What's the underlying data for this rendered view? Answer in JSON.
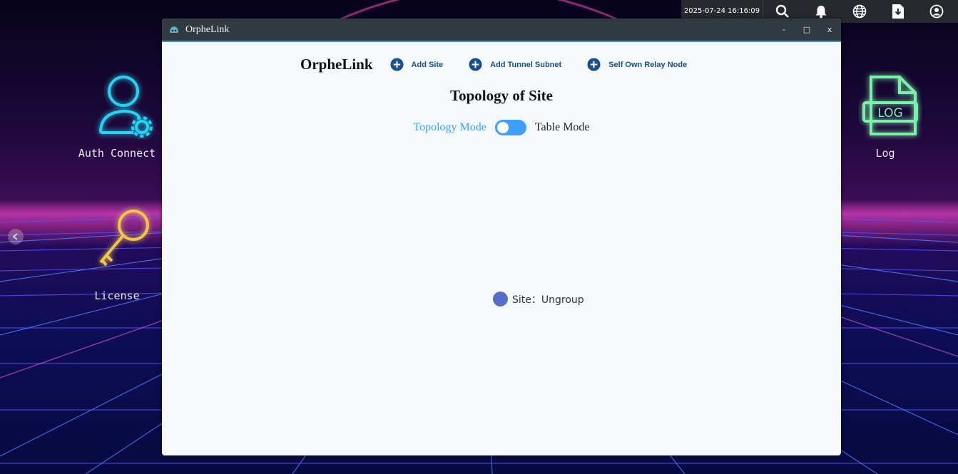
{
  "status_bar": {
    "datetime": "2025-07-24 16:16:09",
    "icons": [
      "search-icon",
      "bell-icon",
      "globe-icon",
      "download-icon",
      "user-circle-icon"
    ]
  },
  "desktop": {
    "items": [
      {
        "label": "Auth Connect",
        "icon": "user-gear-icon",
        "color": "#27d3f2"
      },
      {
        "label": "License",
        "icon": "key-icon",
        "color": "#f0c64a"
      },
      {
        "label": "Log",
        "icon": "log-file-icon",
        "color": "#7df0a8",
        "badge": "LOG"
      }
    ]
  },
  "window": {
    "title": "OrpheLink",
    "controls": {
      "minimize": "-",
      "maximize": "□",
      "close": "x"
    },
    "brand": "OrpheLink",
    "actions": [
      {
        "label": "Add Site"
      },
      {
        "label": "Add Tunnel Subnet"
      },
      {
        "label": "Self Own Relay Node"
      }
    ],
    "page_title": "Topology of Site",
    "mode": {
      "left_label": "Topology Mode",
      "right_label": "Table Mode",
      "selected": "Topology Mode"
    },
    "legend": {
      "label": "Site：Ungroup",
      "color": "#5470c6"
    }
  },
  "colors": {
    "accent": "#409eff",
    "action_text": "#1b4f8c",
    "titlebar": "#313a40"
  }
}
